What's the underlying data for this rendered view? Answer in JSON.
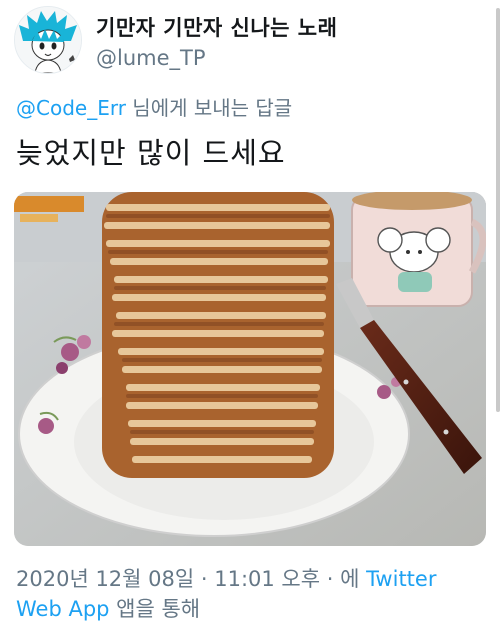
{
  "user": {
    "display_name": "기만자 기만자 신나는 노래",
    "handle": "@lume_TP"
  },
  "reply": {
    "mention": "@Code_Err",
    "suffix": " 님에게 보내는 답글"
  },
  "tweet": {
    "text": "늦었지만 많이 드세요"
  },
  "meta": {
    "timestamp": "2020년 12월 08일 · 11:01 오후 · 에 ",
    "source_link": "Twitter Web App",
    "source_suffix": " 앱을 통해"
  },
  "colors": {
    "link": "#1da1f2",
    "secondary_text": "#657786",
    "primary_text": "#14171a"
  }
}
